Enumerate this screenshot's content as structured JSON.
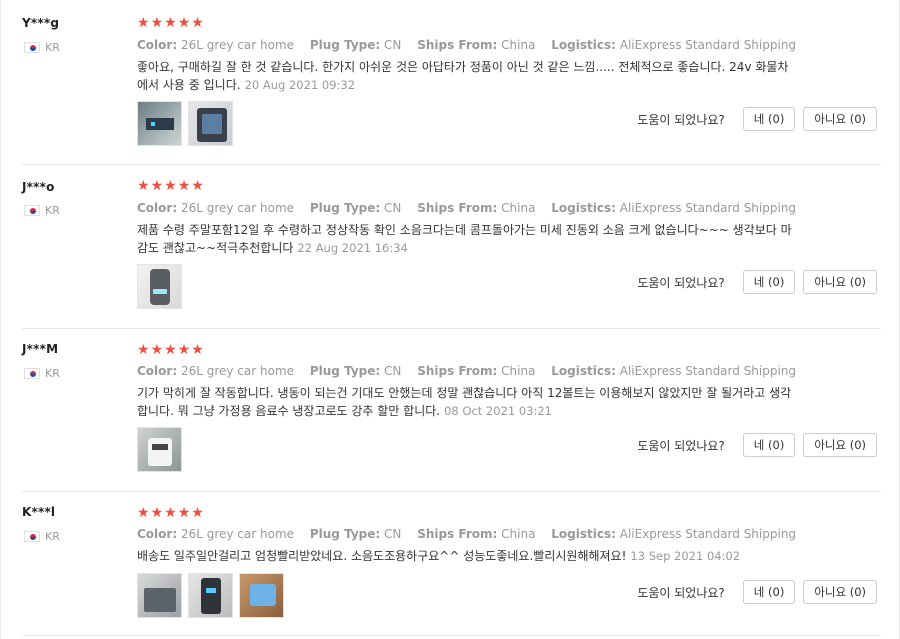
{
  "labels": {
    "color": "Color:",
    "plug": "Plug Type:",
    "ships": "Ships From:",
    "logistics": "Logistics:",
    "helpful": "도움이 되었나요?",
    "yes": "네 (0)",
    "no": "아니요 (0)"
  },
  "reviews": [
    {
      "user": "Y***g",
      "country": "KR",
      "stars": 5,
      "color": "26L grey car home",
      "plug": "CN",
      "ships": "China",
      "logistics": "AliExpress Standard Shipping",
      "text": "좋아요, 구매하길 잘 한 것 같습니다. 한가지 아쉬운 것은 아답타가 정품이 아닌 것 같은 느낌..... 전체적으로 좋습니다. 24v 화물차에서 사용 중 입니다.",
      "date": "20 Aug 2021 09:32",
      "images": 2
    },
    {
      "user": "J***o",
      "country": "KR",
      "stars": 5,
      "color": "26L grey car home",
      "plug": "CN",
      "ships": "China",
      "logistics": "AliExpress Standard Shipping",
      "text": "제품 수령 주말포함12일 후 수령하고 정상작동 확인 소음크다는데 콤프돌아가는 미세 진동외 소음 크게 없습니다~~~ 생각보다 마감도 괜찮고~~적극추천합니다",
      "date": "22 Aug 2021 16:34",
      "images": 1
    },
    {
      "user": "J***M",
      "country": "KR",
      "stars": 5,
      "color": "26L grey car home",
      "plug": "CN",
      "ships": "China",
      "logistics": "AliExpress Standard Shipping",
      "text": "기가 막히게 잘 작동합니다. 냉동이 되는건 기대도 안했는데 정말 괜찮습니다 아직 12볼트는 이용해보지 않았지만 잘 될거라고 생각합니다. 뭐 그냥 가정용 음료수 냉장고로도 강추 할만 합니다.",
      "date": "08 Oct 2021 03:21",
      "images": 1
    },
    {
      "user": "K***l",
      "country": "KR",
      "stars": 5,
      "color": "26L grey car home",
      "plug": "CN",
      "ships": "China",
      "logistics": "AliExpress Standard Shipping",
      "text": "배송도 일주일안걸리고 엄청빨리받았네요. 소음도조용하구요^^ 성능도좋네요.빨리시원해해져요!",
      "date": "13 Sep 2021 04:02",
      "images": 3
    }
  ]
}
